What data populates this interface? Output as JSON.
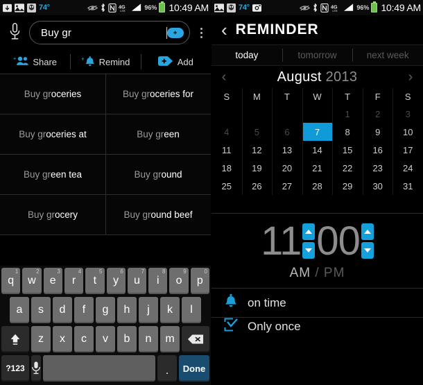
{
  "left": {
    "status_bar": {
      "icons": [
        "download-icon",
        "gallery-icon",
        "app-icon"
      ],
      "temperature": "74°",
      "right_icons": [
        "eye-icon",
        "bluetooth-icon",
        "nfc-icon",
        "lte-icon",
        "signal-icon"
      ],
      "battery_percent": "96%",
      "clock": "10:49 AM"
    },
    "search": {
      "value": "Buy gr",
      "mic_icon": "microphone-icon",
      "add_pill_icon": "add-pill-icon",
      "overflow_icon": "overflow-menu-icon"
    },
    "actions": [
      {
        "icon": "share-people-icon",
        "label": "Share"
      },
      {
        "icon": "remind-bell-icon",
        "label": "Remind"
      },
      {
        "icon": "add-pill-icon",
        "label": "Add"
      }
    ],
    "suggestions": [
      [
        {
          "prefix": "Buy gr",
          "completion": "oceries"
        },
        {
          "prefix": "Buy gr",
          "completion": "oceries for"
        }
      ],
      [
        {
          "prefix": "Buy gr",
          "completion": "oceries at"
        },
        {
          "prefix": "Buy gr",
          "completion": "een"
        }
      ],
      [
        {
          "prefix": "Buy gr",
          "completion": "een tea"
        },
        {
          "prefix": "Buy gr",
          "completion": "ound"
        }
      ],
      [
        {
          "prefix": "Buy gr",
          "completion": "ocery"
        },
        {
          "prefix": "Buy gr",
          "completion": "ound beef"
        }
      ]
    ],
    "keyboard": {
      "row1": [
        {
          "key": "q",
          "num": "1"
        },
        {
          "key": "w",
          "num": "2"
        },
        {
          "key": "e",
          "num": "3"
        },
        {
          "key": "r",
          "num": "4"
        },
        {
          "key": "t",
          "num": "5"
        },
        {
          "key": "y",
          "num": "6"
        },
        {
          "key": "u",
          "num": "7"
        },
        {
          "key": "i",
          "num": "8"
        },
        {
          "key": "o",
          "num": "9"
        },
        {
          "key": "p",
          "num": "0"
        }
      ],
      "row2": [
        "a",
        "s",
        "d",
        "f",
        "g",
        "h",
        "j",
        "k",
        "l"
      ],
      "row3": {
        "shift_icon": "shift-icon",
        "keys": [
          "z",
          "x",
          "c",
          "v",
          "b",
          "n",
          "m"
        ],
        "backspace_icon": "backspace-icon"
      },
      "row4": {
        "symbols_label": "?123",
        "mic_icon": "microphone-icon",
        "space_label": "",
        "period_label": ".",
        "done_label": "Done"
      }
    }
  },
  "right": {
    "status_bar": {
      "icons": [
        "gallery-icon",
        "app-icon"
      ],
      "temperature": "74°",
      "camera_icon": "camera-icon",
      "right_icons": [
        "eye-icon",
        "bluetooth-icon",
        "nfc-icon",
        "lte-icon",
        "signal-icon"
      ],
      "battery_percent": "96%",
      "clock": "10:49 AM"
    },
    "header": {
      "back_icon": "back-chevron-icon",
      "title": "REMINDER"
    },
    "tabs": [
      {
        "label": "today",
        "active": true
      },
      {
        "label": "tomorrow",
        "active": false
      },
      {
        "label": "next week",
        "active": false
      }
    ],
    "calendar": {
      "prev_icon": "prev-month-icon",
      "next_icon": "next-month-icon",
      "month": "August",
      "year": "2013",
      "weekdays": [
        "S",
        "M",
        "T",
        "W",
        "T",
        "F",
        "S"
      ],
      "selected_day": 7,
      "rows": [
        [
          "",
          "",
          "",
          "",
          "1",
          "2",
          "3"
        ],
        [
          "4",
          "5",
          "6",
          "7",
          "8",
          "9",
          "10"
        ],
        [
          "11",
          "12",
          "13",
          "14",
          "15",
          "16",
          "17"
        ],
        [
          "18",
          "19",
          "20",
          "21",
          "22",
          "23",
          "24"
        ],
        [
          "25",
          "26",
          "27",
          "28",
          "29",
          "30",
          "31"
        ]
      ],
      "past_days": [
        "1",
        "2",
        "3",
        "4",
        "5",
        "6"
      ]
    },
    "time": {
      "hour": "11",
      "minute": "00",
      "hour_up_icon": "hour-increment-icon",
      "hour_down_icon": "hour-decrement-icon",
      "minute_up_icon": "minute-increment-icon",
      "minute_down_icon": "minute-decrement-icon",
      "am": "AM",
      "separator": "/",
      "pm": "PM"
    },
    "options": [
      {
        "icon": "bell-icon",
        "label": "on time"
      },
      {
        "icon": "repeat-check-icon",
        "label": "Only once"
      }
    ]
  },
  "colors": {
    "accent_blue": "#14a0da",
    "selected_day_blue": "#0f9bd7",
    "done_button_blue": "#1a4c70",
    "battery_green": "#6cc24a",
    "background": "#000000"
  }
}
